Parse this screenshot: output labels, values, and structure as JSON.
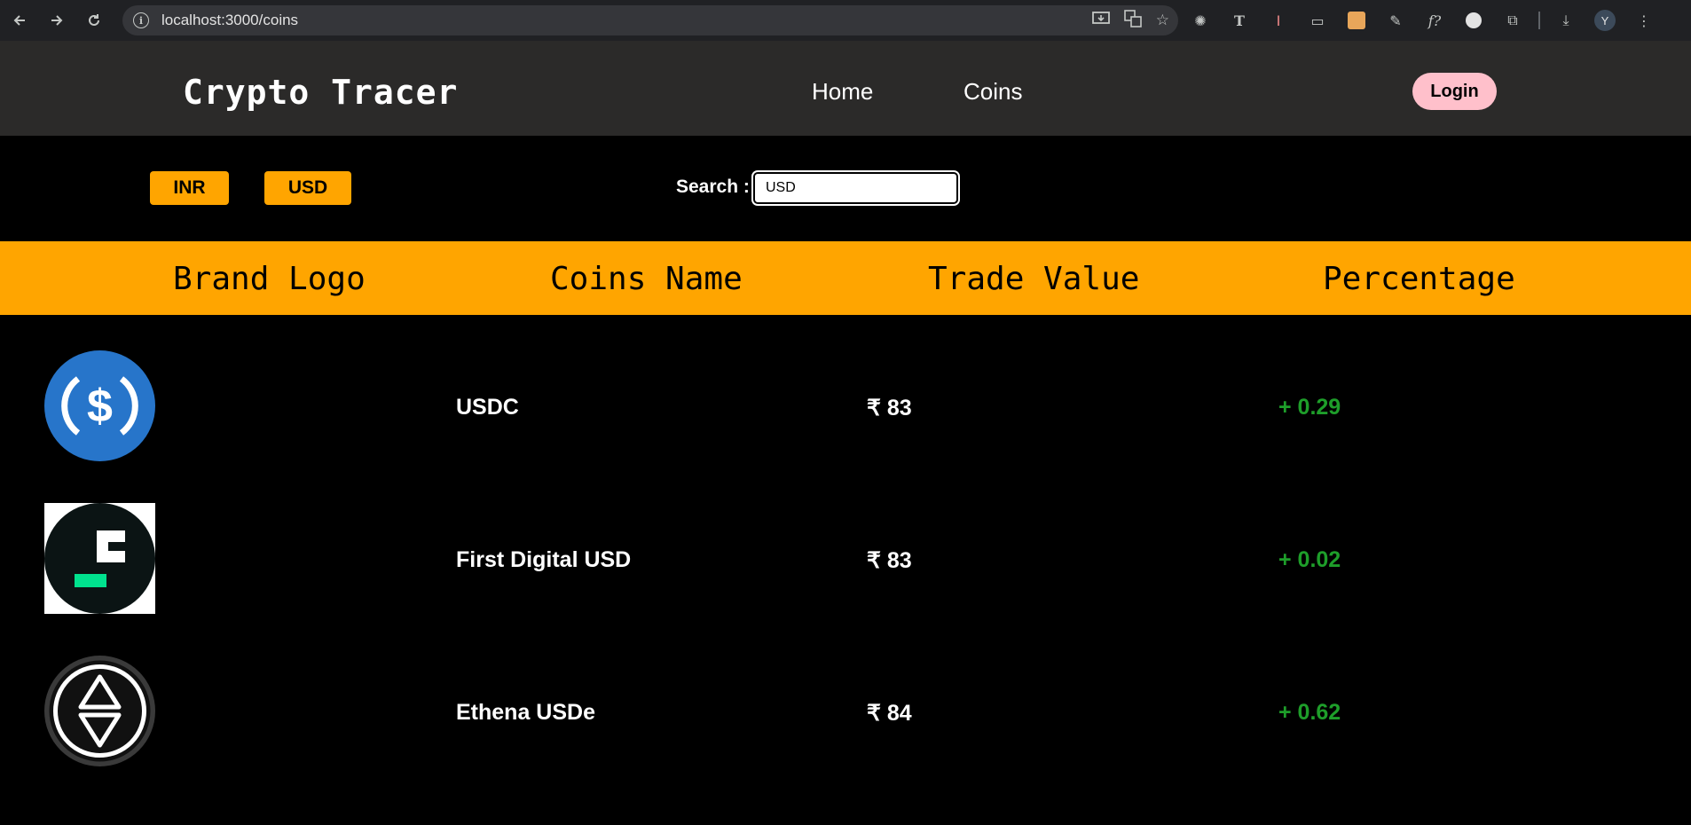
{
  "browser": {
    "url": "localhost:3000/coins",
    "avatar_letter": "Y"
  },
  "header": {
    "brand": "Crypto Tracer",
    "nav": [
      "Home",
      "Coins"
    ],
    "login_label": "Login"
  },
  "controls": {
    "currencies": [
      "INR",
      "USD"
    ],
    "search_label": "Search :",
    "search_value": "USD"
  },
  "table": {
    "columns": [
      "Brand Logo",
      "Coins Name",
      "Trade Value",
      "Percentage"
    ],
    "rows": [
      {
        "logo": "usdc-logo",
        "name": "USDC",
        "value": "₹ 83",
        "percentage": "+ 0.29"
      },
      {
        "logo": "first-digital-usd-logo",
        "name": "First Digital USD",
        "value": "₹ 83",
        "percentage": "+ 0.02"
      },
      {
        "logo": "ethena-usde-logo",
        "name": "Ethena USDe",
        "value": "₹ 84",
        "percentage": "+ 0.62"
      }
    ]
  },
  "colors": {
    "accent": "#ffa500",
    "header_bg": "#2b2a29",
    "login_bg": "#ffc0cb",
    "positive": "#1e9e2a"
  }
}
